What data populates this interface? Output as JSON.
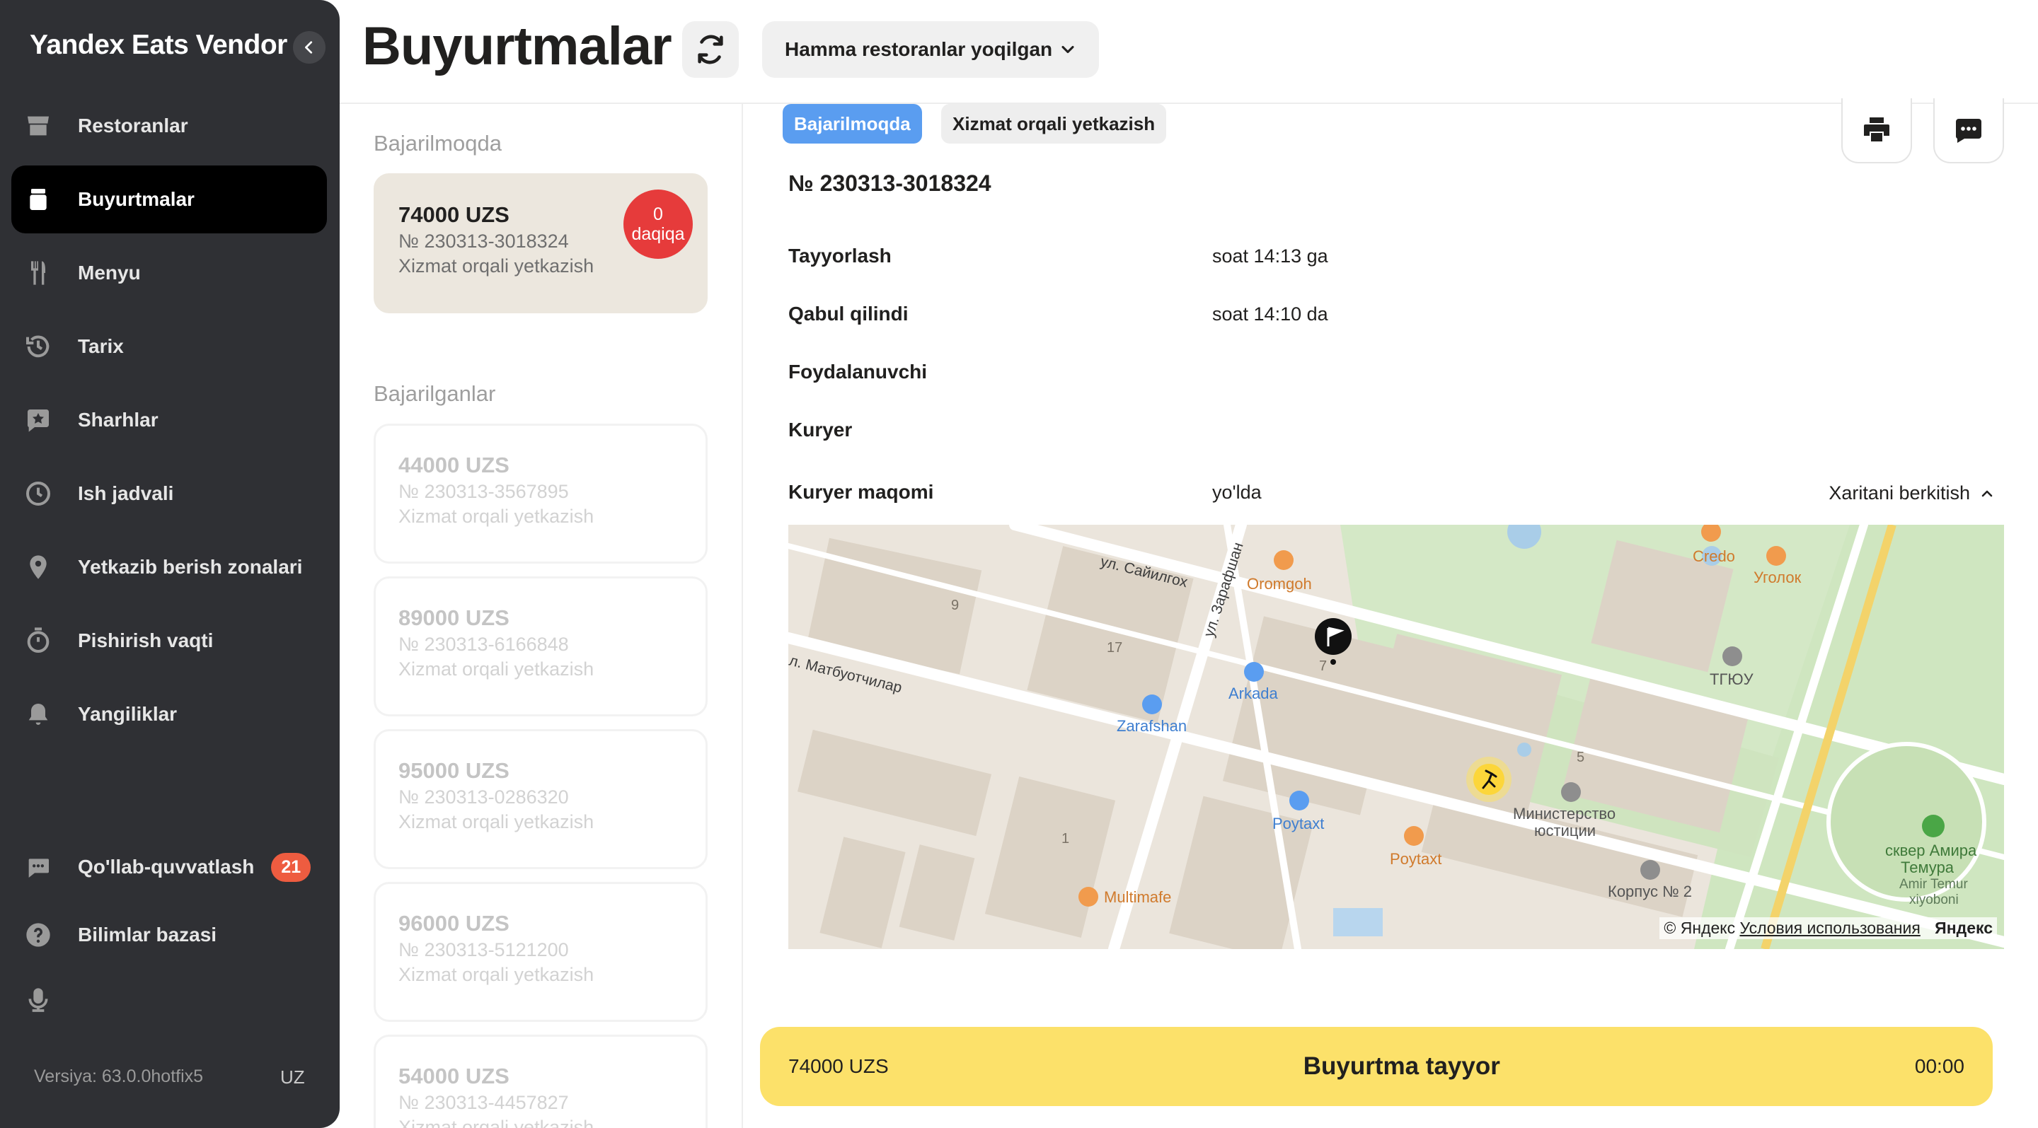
{
  "app": {
    "brand": "Yandex Eats Vendor",
    "version": "Versiya: 63.0.0hotfix5",
    "lang": "UZ"
  },
  "sidebar": {
    "items": [
      {
        "id": "restoranlar",
        "label": "Restoranlar",
        "icon": "store-icon"
      },
      {
        "id": "buyurtmalar",
        "label": "Buyurtmalar",
        "icon": "order-bag-icon",
        "active": true
      },
      {
        "id": "menyu",
        "label": "Menyu",
        "icon": "fork-knife-icon"
      },
      {
        "id": "tarix",
        "label": "Tarix",
        "icon": "history-icon"
      },
      {
        "id": "sharhlar",
        "label": "Sharhlar",
        "icon": "review-star-icon"
      },
      {
        "id": "ish-jadvali",
        "label": "Ish jadvali",
        "icon": "clock-icon"
      },
      {
        "id": "yetkazib",
        "label": "Yetkazib berish zonalari",
        "icon": "location-pin-icon"
      },
      {
        "id": "pishirish",
        "label": "Pishirish vaqti",
        "icon": "stopwatch-icon"
      },
      {
        "id": "yangiliklar",
        "label": "Yangiliklar",
        "icon": "bell-icon"
      }
    ],
    "bottom": [
      {
        "id": "support",
        "label": "Qo'llab-quvvatlash",
        "icon": "chat-icon",
        "badge": "21"
      },
      {
        "id": "knowledge",
        "label": "Bilimlar bazasi",
        "icon": "help-icon"
      },
      {
        "id": "mic",
        "label": "",
        "icon": "microphone-icon"
      }
    ]
  },
  "header": {
    "title": "Buyurtmalar",
    "restaurant_select": "Hamma restoranlar yoqilgan"
  },
  "orders": {
    "in_progress_title": "Bajarilmoqda",
    "in_progress": [
      {
        "amount": "74000 UZS",
        "number": "№ 230313-3018324",
        "type": "Xizmat orqali yetkazish",
        "timer_value": "0",
        "timer_unit": "daqiqa"
      }
    ],
    "done_title": "Bajarilganlar",
    "done": [
      {
        "amount": "44000 UZS",
        "number": "№ 230313-3567895",
        "type": "Xizmat orqali yetkazish"
      },
      {
        "amount": "89000 UZS",
        "number": "№ 230313-6166848",
        "type": "Xizmat orqali yetkazish"
      },
      {
        "amount": "95000 UZS",
        "number": "№ 230313-0286320",
        "type": "Xizmat orqali yetkazish"
      },
      {
        "amount": "96000 UZS",
        "number": "№ 230313-5121200",
        "type": "Xizmat orqali yetkazish"
      },
      {
        "amount": "54000 UZS",
        "number": "№ 230313-4457827",
        "type": "Xizmat orqali yetkazish"
      }
    ]
  },
  "detail": {
    "status_tag": "Bajarilmoqda",
    "delivery_tag": "Xizmat orqali yetkazish",
    "order_number": "№ 230313-3018324",
    "rows": [
      {
        "label": "Tayyorlash",
        "value": "soat 14:13 ga"
      },
      {
        "label": "Qabul qilindi",
        "value": "soat 14:10 da"
      },
      {
        "label": "Foydalanuvchi",
        "value": ""
      },
      {
        "label": "Kuryer",
        "value": ""
      },
      {
        "label": "Kuryer maqomi",
        "value": "yo'lda"
      }
    ],
    "map_toggle": "Xaritani berkitish",
    "map": {
      "streets": [
        "ул. Сайилгох",
        "ул. Зарафшан",
        "л. Матбуотчилар"
      ],
      "pois": [
        "Oromgoh",
        "Arkada",
        "Zarafshan",
        "Poytaxt",
        "Poytaxt",
        "Multimafe",
        "Credo",
        "Уголок",
        "ТГЮУ",
        "Министерство",
        "юстиции",
        "Корпус № 2",
        "сквер Амира",
        "Темура",
        "Amir Temur",
        "xiyoboni"
      ],
      "house_numbers": [
        "9",
        "17",
        "7",
        "5",
        "1"
      ],
      "attribution": "© Яндекс",
      "terms": "Условия использования",
      "logo": "Яндекс"
    }
  },
  "ready_bar": {
    "sum": "74000 UZS",
    "action": "Buyurtma tayyor",
    "time": "00:00"
  }
}
